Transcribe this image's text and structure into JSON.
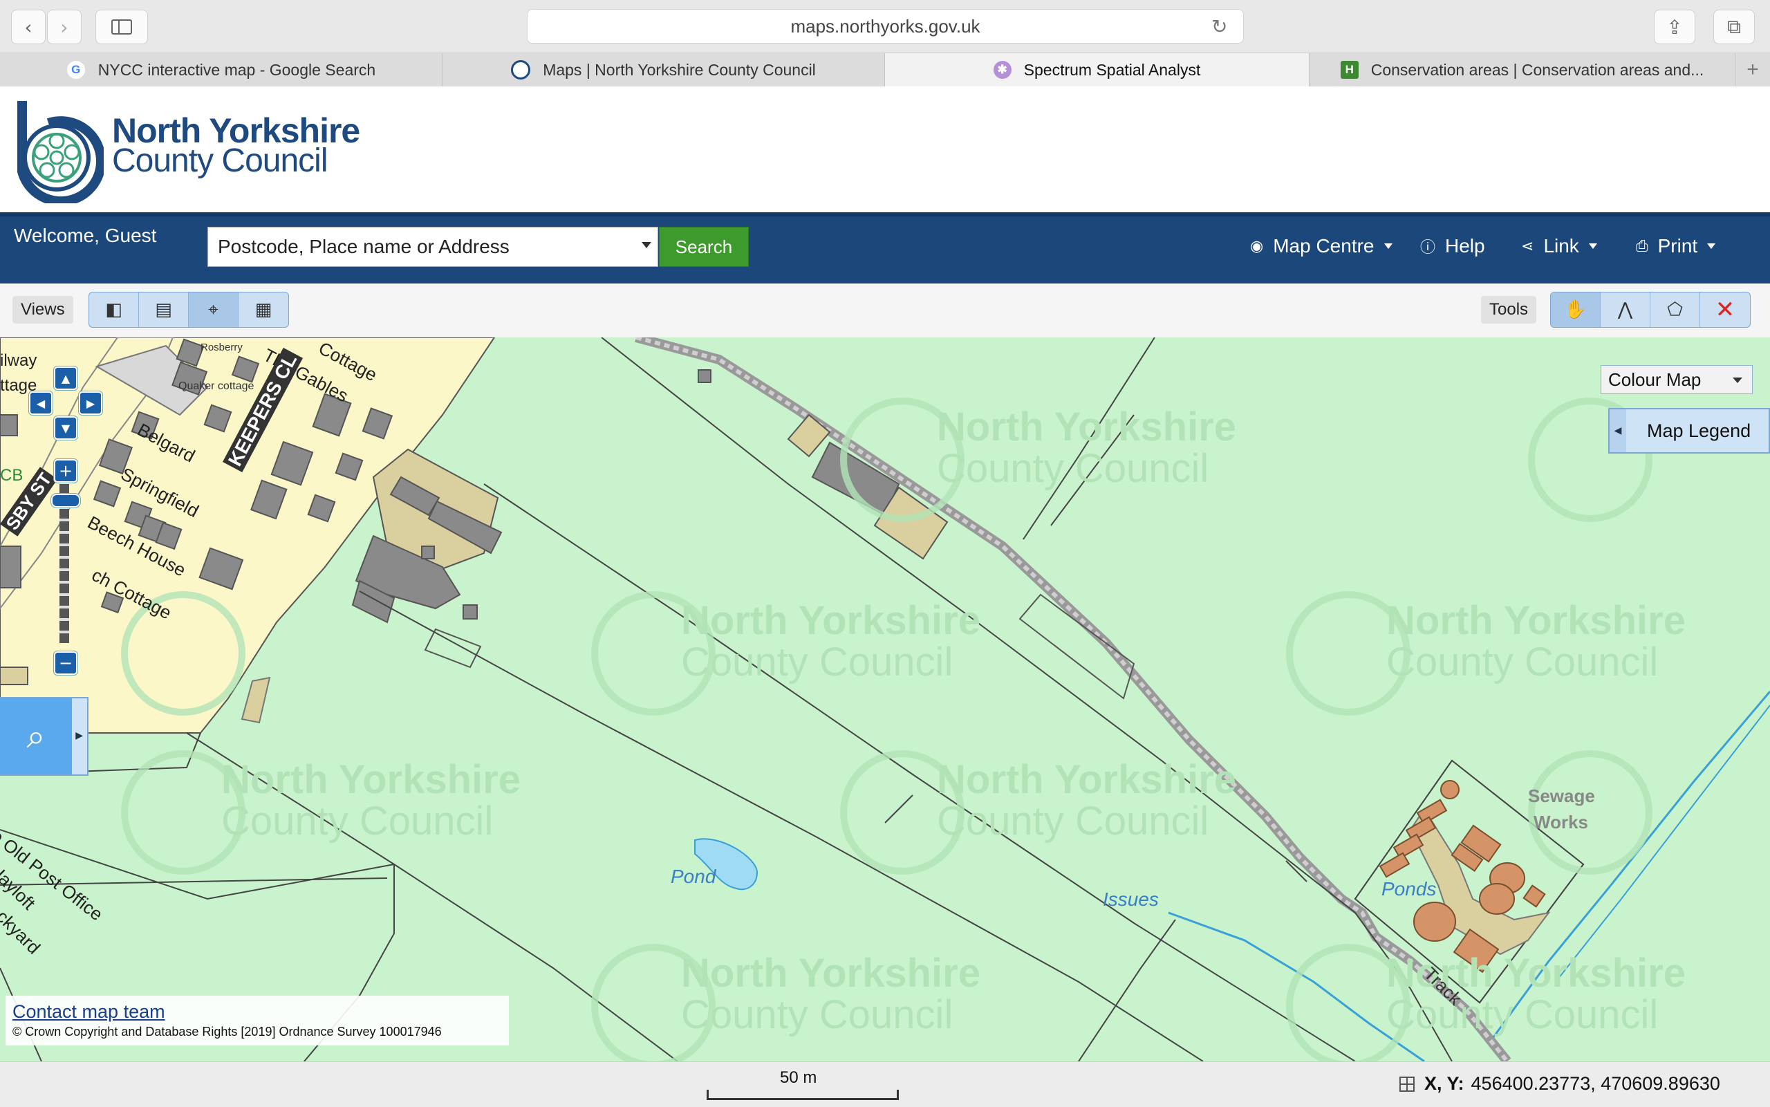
{
  "browser": {
    "url": "maps.northyorks.gov.uk",
    "tabs": [
      {
        "label": "NYCC interactive map - Google Search",
        "icon": "google-icon",
        "color": "#ffffff"
      },
      {
        "label": "Maps | North Yorkshire County Council",
        "icon": "nycc-logo-icon",
        "color": "#ffffff"
      },
      {
        "label": "Spectrum Spatial Analyst",
        "icon": "spectrum-icon",
        "color": "#b68fd9",
        "active": true
      },
      {
        "label": "Conservation areas | Conservation areas and...",
        "icon": "h-icon",
        "color": "#3b8a2f"
      }
    ]
  },
  "header": {
    "logo_line1": "North Yorkshire",
    "logo_line2": "County Council",
    "brand_color": "#1f4a80"
  },
  "topbar": {
    "welcome": "Welcome, Guest",
    "search_placeholder": "Postcode, Place name or Address",
    "search_button": "Search",
    "menu": {
      "map_centre": "Map Centre",
      "help": "Help",
      "link": "Link",
      "print": "Print"
    }
  },
  "viewsbar": {
    "views_label": "Views",
    "tools_label": "Tools"
  },
  "map": {
    "colour_map": "Colour Map",
    "map_legend": "Map Legend",
    "labels": {
      "pond": "Pond",
      "ponds": "Ponds",
      "issues": "Issues",
      "sewage": "Sewage",
      "works": "Works",
      "track": "Track",
      "keepers_cl": "KEEPERS CL",
      "the_gables": "The Gables",
      "cottage": "Cottage",
      "belgard": "Belgard",
      "springfield": "Springfield",
      "beech_house": "Beech House",
      "ch_cottage": "ch Cottage",
      "quaker_cottage": "Quaker cottage",
      "rosberry": "Rosberry",
      "old_post_office": "e Old Post Office",
      "hayloft": "Hayloft",
      "ackyard": "ackyard",
      "ilway": "ilway",
      "ttage": "ttage",
      "cb": "CB",
      "sby_st": "SBY ST",
      "watermark1": "North Yorkshire",
      "watermark2": "County Council"
    },
    "contact": "Contact map team",
    "copyright": "© Crown Copyright and Database Rights [2019] Ordnance Survey 100017946"
  },
  "status": {
    "scale": "50 m",
    "coords_label": "X, Y:",
    "coords_value": "456400.23773, 470609.89630"
  }
}
